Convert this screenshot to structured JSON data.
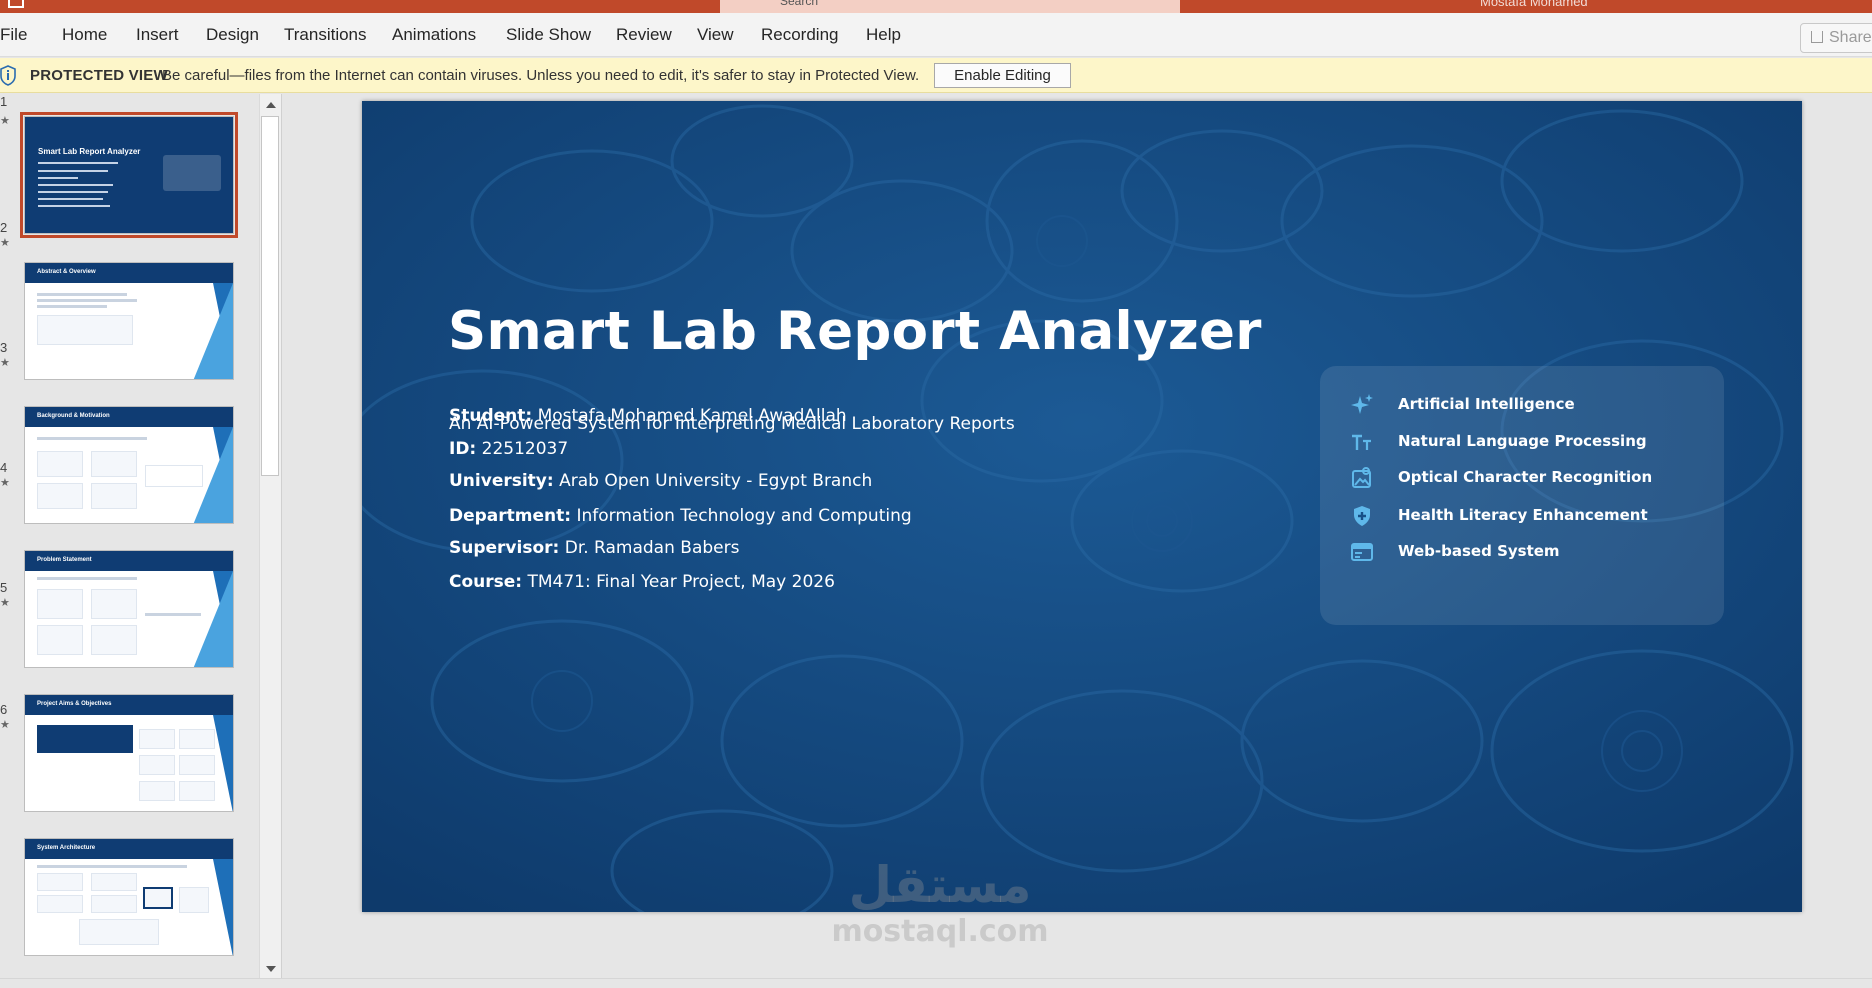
{
  "colors": {
    "accent": "#c0492a",
    "slide_bg": "#174f87",
    "protected_bar": "#fdf6c9"
  },
  "titlebar": {
    "search_placeholder": "Search",
    "user_name": "Mostafa Mohamed"
  },
  "ribbon": {
    "tabs": [
      "File",
      "Home",
      "Insert",
      "Design",
      "Transitions",
      "Animations",
      "Slide Show",
      "Review",
      "View",
      "Recording",
      "Help"
    ],
    "share_label": "Share"
  },
  "protected_view": {
    "label": "PROTECTED VIEW",
    "message": "Be careful—files from the Internet can contain viruses. Unless you need to edit, it's safer to stay in Protected View.",
    "button": "Enable Editing"
  },
  "thumbnails": [
    {
      "num": "1",
      "title": "Smart Lab Report Analyzer",
      "active": true
    },
    {
      "num": "2",
      "title": "Abstract & Overview"
    },
    {
      "num": "3",
      "title": "Background & Motivation"
    },
    {
      "num": "4",
      "title": "Problem Statement"
    },
    {
      "num": "5",
      "title": "Project Aims & Objectives"
    },
    {
      "num": "6",
      "title": "System Architecture"
    }
  ],
  "slide": {
    "title": "Smart Lab Report Analyzer",
    "subtitle": "An AI-Powered System for Interpreting Medical Laboratory Reports",
    "fields": [
      {
        "label": "Student:",
        "value": "Mostafa Mohamed Kamel AwadAllah"
      },
      {
        "label": "ID:",
        "value": "22512037"
      },
      {
        "label": "University:",
        "value": "Arab Open University - Egypt Branch"
      },
      {
        "label": "Department:",
        "value": "Information Technology and Computing"
      },
      {
        "label": "Supervisor:",
        "value": "Dr. Ramadan Babers"
      },
      {
        "label": "Course:",
        "value": "TM471: Final Year Project, May 2026"
      }
    ],
    "features": [
      {
        "icon": "sparkle-icon",
        "label": "Artificial Intelligence"
      },
      {
        "icon": "text-size-icon",
        "label": "Natural Language Processing"
      },
      {
        "icon": "image-scan-icon",
        "label": "Optical Character Recognition"
      },
      {
        "icon": "shield-plus-icon",
        "label": "Health Literacy Enhancement"
      },
      {
        "icon": "browser-window-icon",
        "label": "Web-based System"
      }
    ]
  },
  "watermark": {
    "arabic": "مستقل",
    "latin": "mostaql.com"
  }
}
